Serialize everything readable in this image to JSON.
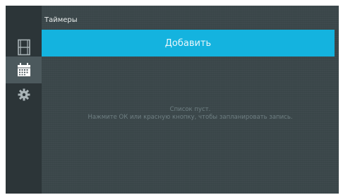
{
  "header": {
    "title": "Таймеры"
  },
  "sidebar": {
    "items": [
      {
        "id": "recordings",
        "icon": "film-icon",
        "active": false
      },
      {
        "id": "timers",
        "icon": "calendar-icon",
        "active": true
      },
      {
        "id": "settings",
        "icon": "gear-icon",
        "active": false
      }
    ]
  },
  "main": {
    "add_label": "Добавить",
    "empty_title": "Список пуст.",
    "empty_hint": "Нажмите ОК или красную кнопку, чтобы запланировать запись."
  },
  "colors": {
    "accent": "#14b3df",
    "background": "#3b474a",
    "sidebar": "#2c3538",
    "sidebar_active": "#4c595d",
    "muted_text": "#6f7f83"
  }
}
